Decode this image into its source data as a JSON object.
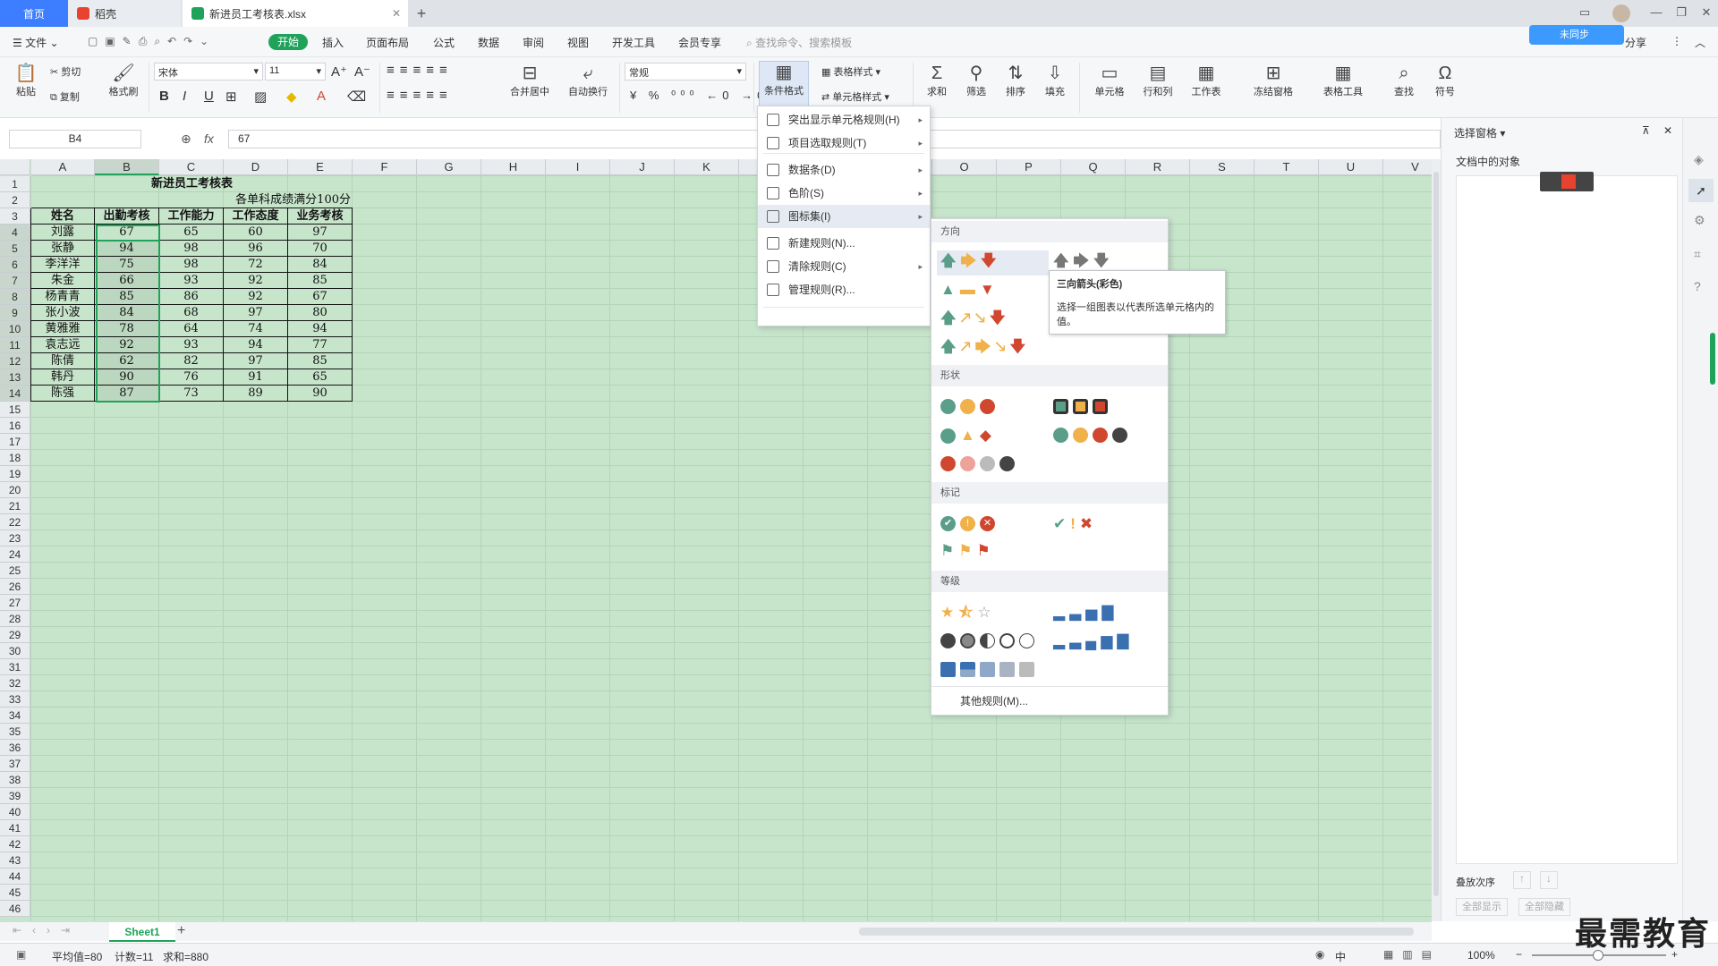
{
  "tabs": {
    "home": "首页",
    "daoke": "稻壳",
    "file": "新进员工考核表.xlsx"
  },
  "menu": {
    "file": "文件",
    "start": "开始",
    "items": [
      "插入",
      "页面布局",
      "公式",
      "数据",
      "审阅",
      "视图",
      "开发工具",
      "会员专享"
    ],
    "search": "查找命令、搜索模板",
    "share": "分享",
    "sync": "未同步"
  },
  "ribbon": {
    "paste": "粘贴",
    "cut": "剪切",
    "copy": "复制",
    "format_painter": "格式刷",
    "font": "宋体",
    "font_size": "11",
    "merge": "合并居中",
    "wrap": "自动换行",
    "number_format": "常规",
    "cond_format": "条件格式",
    "table_style": "表格样式",
    "cell_style": "单元格样式",
    "sum": "求和",
    "filter": "筛选",
    "sort": "排序",
    "fill": "填充",
    "cell": "单元格",
    "rowcol": "行和列",
    "sheet": "工作表",
    "freeze": "冻结窗格",
    "table_tools": "表格工具",
    "find": "查找",
    "symbol": "符号"
  },
  "formula": {
    "namebox": "B4",
    "fx": "fx",
    "value": "67"
  },
  "columns": [
    "A",
    "B",
    "C",
    "D",
    "E",
    "F",
    "G",
    "H",
    "I",
    "J",
    "K",
    "L",
    "M",
    "N",
    "O",
    "P",
    "Q",
    "R",
    "S",
    "T",
    "U",
    "V"
  ],
  "sheet": {
    "title": "新进员工考核表",
    "subtitle": "各单科成绩满分100分",
    "headers": [
      "姓名",
      "出勤考核",
      "工作能力",
      "工作态度",
      "业务考核"
    ],
    "rows": [
      [
        "刘露",
        "67",
        "65",
        "60",
        "97"
      ],
      [
        "张静",
        "94",
        "98",
        "96",
        "70"
      ],
      [
        "李洋洋",
        "75",
        "98",
        "72",
        "84"
      ],
      [
        "朱金",
        "66",
        "93",
        "92",
        "85"
      ],
      [
        "杨青青",
        "85",
        "86",
        "92",
        "67"
      ],
      [
        "张小波",
        "84",
        "68",
        "97",
        "80"
      ],
      [
        "黄雅雅",
        "78",
        "64",
        "74",
        "94"
      ],
      [
        "袁志远",
        "92",
        "93",
        "94",
        "77"
      ],
      [
        "陈倩",
        "62",
        "82",
        "97",
        "85"
      ],
      [
        "韩丹",
        "90",
        "76",
        "91",
        "65"
      ],
      [
        "陈强",
        "87",
        "73",
        "89",
        "90"
      ]
    ]
  },
  "cf_menu": [
    {
      "label": "突出显示单元格规则(H)",
      "arrow": true
    },
    {
      "label": "项目选取规则(T)",
      "arrow": true
    },
    {
      "label": "数据条(D)",
      "arrow": true
    },
    {
      "label": "色阶(S)",
      "arrow": true
    },
    {
      "label": "图标集(I)",
      "arrow": true
    },
    {
      "label": "新建规则(N)...",
      "arrow": false
    },
    {
      "label": "清除规则(C)",
      "arrow": true
    },
    {
      "label": "管理规则(R)...",
      "arrow": false
    }
  ],
  "iconsets": {
    "direction": "方向",
    "shape": "形状",
    "mark": "标记",
    "grade": "等级",
    "more": "其他规则(M)..."
  },
  "tooltip": {
    "title": "三向箭头(彩色)",
    "desc": "选择一组图表以代表所选单元格内的值。"
  },
  "rpanel": {
    "title": "选择窗格",
    "objects": "文档中的对象",
    "order": "叠放次序",
    "show_all": "全部显示",
    "hide_all": "全部隐藏"
  },
  "sheettab": "Sheet1",
  "status": {
    "avg": "平均值=80",
    "count": "计数=11",
    "sum": "求和=880",
    "zoom": "100%",
    "lang": "中"
  },
  "watermark": "最需教育",
  "colors": {
    "green": "#5a9e8a",
    "orange": "#f0b04a",
    "red": "#d0472f",
    "grid_bg": "#c7e5cb",
    "accent": "#3c7eff"
  }
}
